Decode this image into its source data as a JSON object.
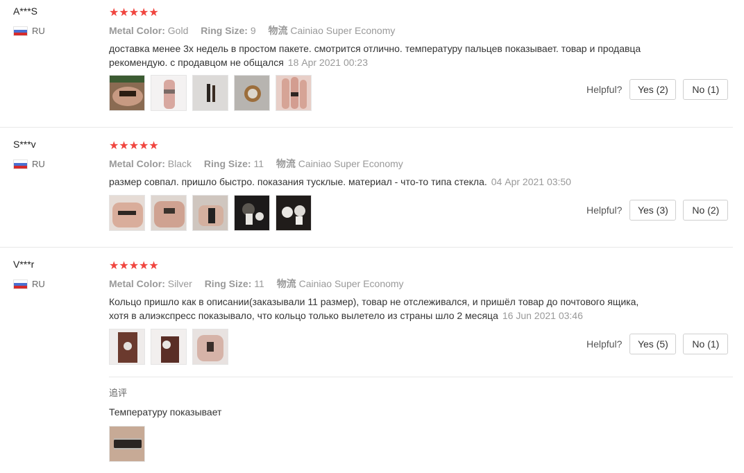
{
  "helpful_label": "Helpful?",
  "reviews": [
    {
      "user": "A***S",
      "country": "RU",
      "stars": "★★★★★",
      "rating": 5,
      "attr_color_label": "Metal Color:",
      "attr_color_value": "Gold",
      "attr_size_label": "Ring Size:",
      "attr_size_value": "9",
      "attr_ship_label": "物流",
      "attr_ship_value": "Cainiao Super Economy",
      "text": "доставка менее 3х недель в простом пакете. смотрится отлично. температуру пальцев показывает. товар и продавца рекомендую. с продавцом не общался",
      "date": "18 Apr 2021 00:23",
      "yes_label": "Yes (2)",
      "no_label": "No (1)"
    },
    {
      "user": "S***v",
      "country": "RU",
      "stars": "★★★★★",
      "rating": 5,
      "attr_color_label": "Metal Color:",
      "attr_color_value": "Black",
      "attr_size_label": "Ring Size:",
      "attr_size_value": "11",
      "attr_ship_label": "物流",
      "attr_ship_value": "Cainiao Super Economy",
      "text": "размер совпал. пришло быстро. показания тусклые. материал - что-то типа стекла.",
      "date": "04 Apr 2021 03:50",
      "yes_label": "Yes (3)",
      "no_label": "No (2)"
    },
    {
      "user": "V***r",
      "country": "RU",
      "stars": "★★★★★",
      "rating": 5,
      "attr_color_label": "Metal Color:",
      "attr_color_value": "Silver",
      "attr_size_label": "Ring Size:",
      "attr_size_value": "11",
      "attr_ship_label": "物流",
      "attr_ship_value": "Cainiao Super Economy",
      "text": "Кольцо пришло как в описании(заказывали 11 размер), товар не отслеживался, и пришёл товар до почтового ящика, хотя в алиэкспресс показывало, что кольцо только вылетело из страны шло 2 месяца",
      "date": "16 Jun 2021 03:46",
      "yes_label": "Yes (5)",
      "no_label": "No (1)",
      "followup_label": "追评",
      "followup_text": "Температуру показывает"
    }
  ]
}
